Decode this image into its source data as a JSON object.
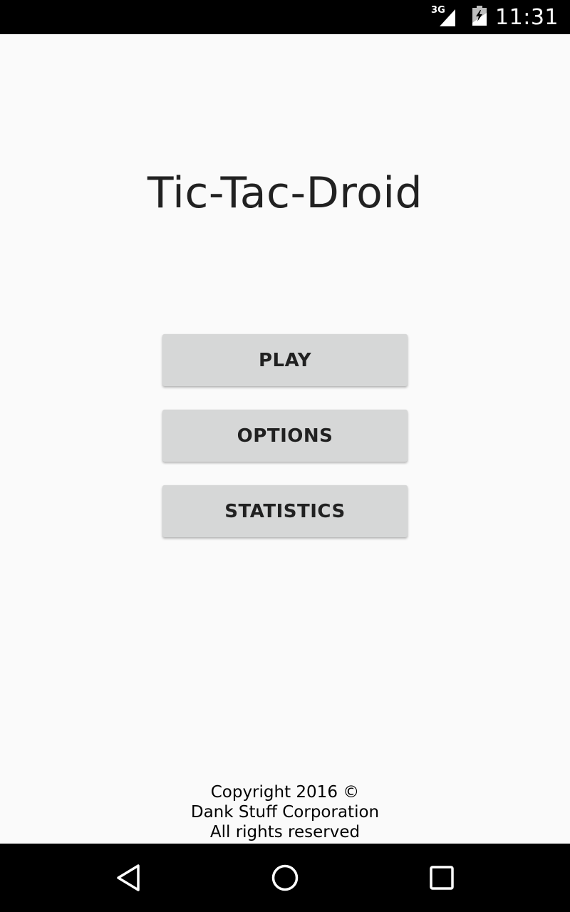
{
  "status_bar": {
    "network": "3G",
    "time": "11:31"
  },
  "app": {
    "title": "Tic-Tac-Droid"
  },
  "menu": {
    "play_label": "PLAY",
    "options_label": "OPTIONS",
    "statistics_label": "STATISTICS"
  },
  "footer": {
    "line1": "Copyright 2016 ©",
    "line2": "Dank Stuff Corporation",
    "line3": "All rights reserved"
  },
  "nav_bar": {
    "icons": [
      "back-icon",
      "home-icon",
      "recents-icon"
    ]
  },
  "colors": {
    "background": "#fafafa",
    "button": "#d6d7d7",
    "bars": "#000000",
    "text": "#212121"
  }
}
